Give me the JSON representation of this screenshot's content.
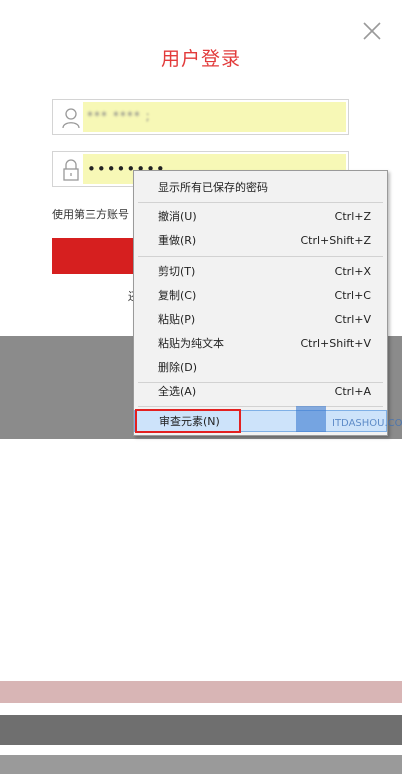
{
  "dialog": {
    "title": "用户登录",
    "username_value": "*** **** ;",
    "password_value": "••••••••",
    "third_party_text": "使用第三方账号",
    "register_text": "还"
  },
  "context_menu": {
    "items": [
      {
        "label": "显示所有已保存的密码",
        "shortcut": ""
      },
      {
        "label": "撤消(U)",
        "shortcut": "Ctrl+Z"
      },
      {
        "label": "重做(R)",
        "shortcut": "Ctrl+Shift+Z"
      },
      {
        "label": "剪切(T)",
        "shortcut": "Ctrl+X"
      },
      {
        "label": "复制(C)",
        "shortcut": "Ctrl+C"
      },
      {
        "label": "粘贴(P)",
        "shortcut": "Ctrl+V"
      },
      {
        "label": "粘贴为纯文本",
        "shortcut": "Ctrl+Shift+V"
      },
      {
        "label": "删除(D)",
        "shortcut": ""
      },
      {
        "label": "全选(A)",
        "shortcut": "Ctrl+A"
      },
      {
        "label": "审查元素(N)",
        "shortcut": ""
      }
    ]
  },
  "watermark": {
    "text": "ITDASHOU.COM"
  },
  "colors": {
    "accent": "#e23b3b",
    "button": "#d61f1f",
    "autofill": "#f7f8b6",
    "highlight": "#cde3fa",
    "annotation": "#e32020"
  }
}
